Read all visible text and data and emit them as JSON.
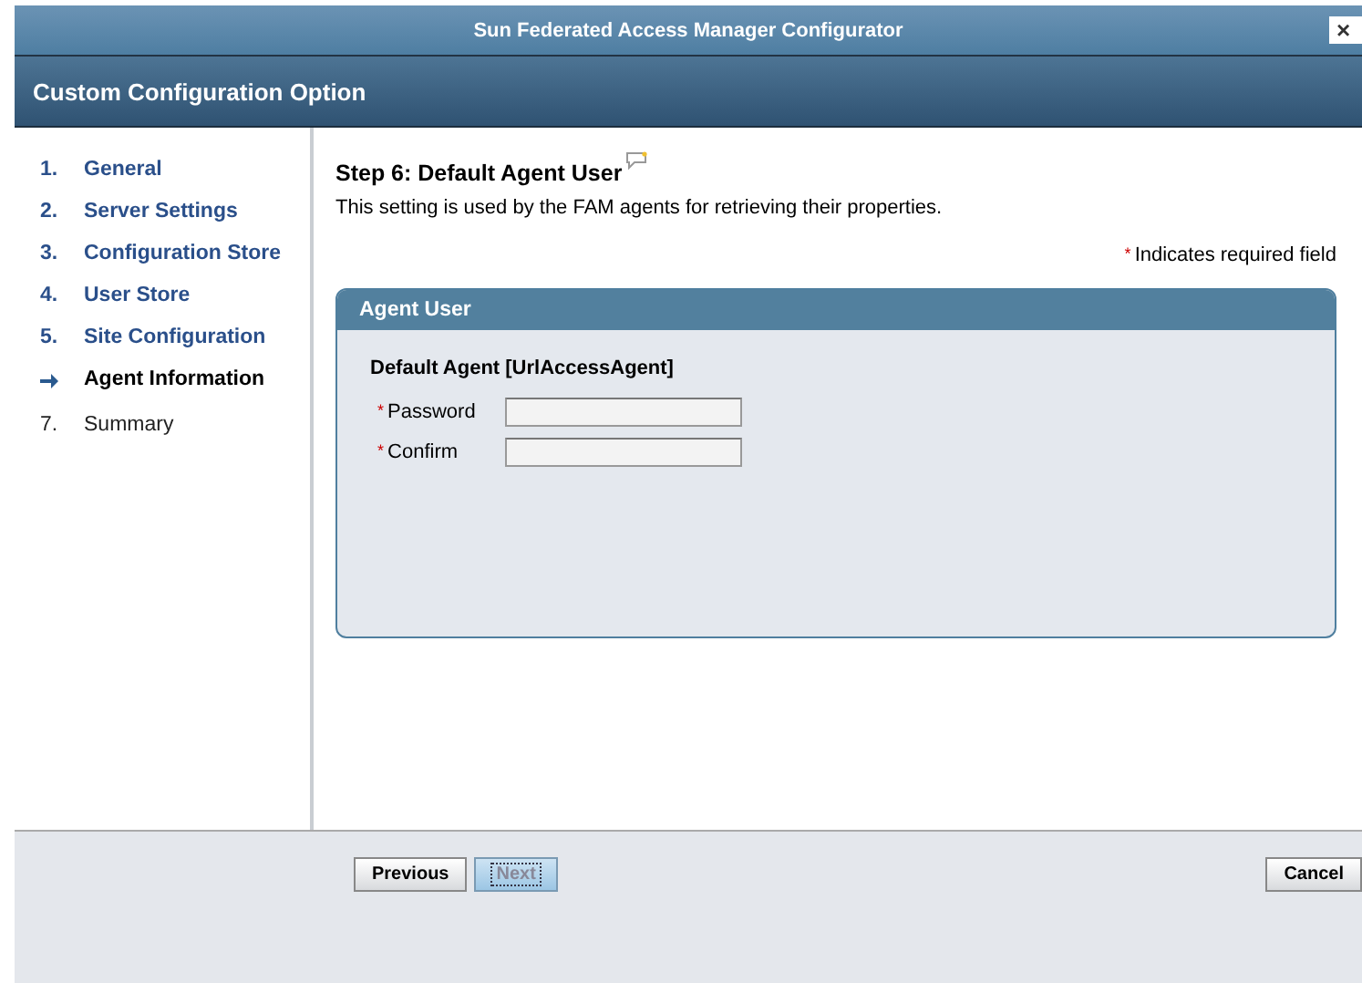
{
  "window": {
    "title": "Sun Federated Access Manager Configurator",
    "close": "×"
  },
  "header": {
    "title": "Custom Configuration Option"
  },
  "steps": [
    {
      "number": "1.",
      "label": "General",
      "selected": false,
      "completed": true
    },
    {
      "number": "2.",
      "label": "Server Settings",
      "selected": false,
      "completed": true
    },
    {
      "number": "3.",
      "label": "Configuration Store",
      "selected": false,
      "completed": true
    },
    {
      "number": "4.",
      "label": "User Store",
      "selected": false,
      "completed": true
    },
    {
      "number": "5.",
      "label": "Site Configuration",
      "selected": false,
      "completed": true
    },
    {
      "label": "Agent Information",
      "selected": true,
      "completed": false
    },
    {
      "number": "7.",
      "label": "Summary",
      "selected": false,
      "completed": false
    }
  ],
  "content": {
    "title": "Step 6: Default Agent User",
    "description": "This setting is used by the FAM agents for retrieving their properties.",
    "required_marker": "*",
    "required_note": "Indicates required field",
    "panel": {
      "title": "Agent User",
      "subtitle": "Default Agent [UrlAccessAgent]",
      "fields": [
        {
          "label": "Password",
          "required": true
        },
        {
          "label": "Confirm",
          "required": true
        }
      ]
    }
  },
  "footer": {
    "left_buttons": [
      {
        "label": "Previous",
        "disabled": false
      },
      {
        "label": "Next",
        "disabled": true
      }
    ],
    "right_buttons": [
      {
        "label": "Cancel",
        "disabled": false
      }
    ]
  }
}
